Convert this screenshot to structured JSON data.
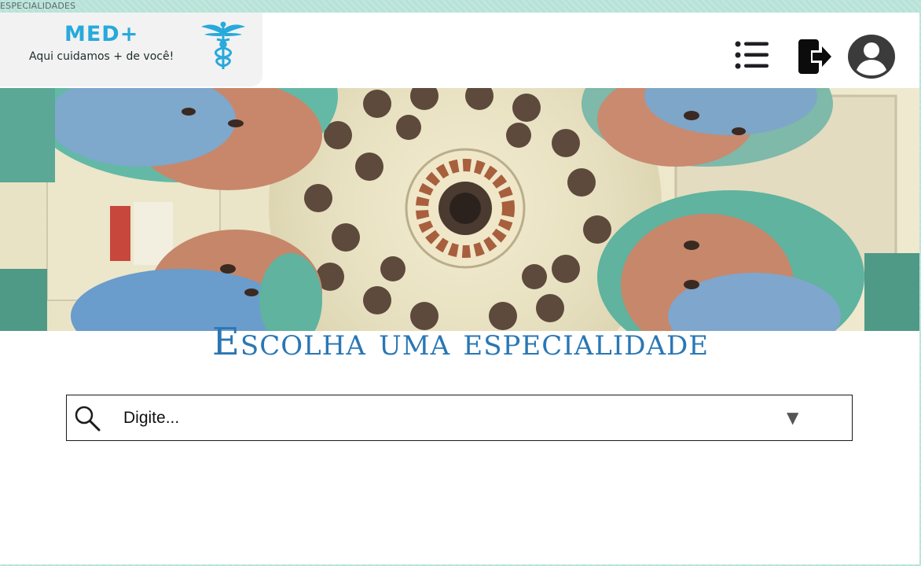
{
  "window": {
    "title": "ESPECIALIDADES"
  },
  "brand": {
    "name": "MED+",
    "tagline": "Aqui cuidamos + de você!",
    "icon": "caduceus-icon",
    "color": "#27a9dc"
  },
  "header": {
    "menu_icon": "list-menu-icon",
    "logout_icon": "logout-icon",
    "profile_icon": "user-avatar-icon"
  },
  "hero": {
    "image": "surgeons-looking-down-under-operating-lamp"
  },
  "main": {
    "title": "Escolha uma especialidade",
    "title_color": "#2a77b4"
  },
  "search": {
    "placeholder": "Digite...",
    "value": "",
    "icon": "search-icon",
    "dropdown_icon": "triangle-down-icon"
  }
}
